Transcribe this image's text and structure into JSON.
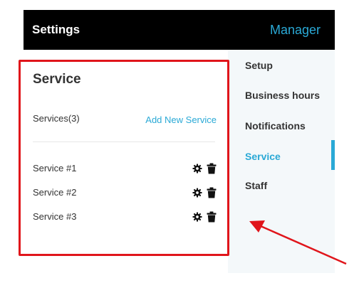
{
  "header": {
    "title": "Settings",
    "role": "Manager"
  },
  "sidebar": {
    "items": [
      {
        "label": "Setup"
      },
      {
        "label": "Business hours"
      },
      {
        "label": "Notifications"
      },
      {
        "label": "Service"
      },
      {
        "label": "Staff"
      }
    ],
    "active": "Service"
  },
  "panel": {
    "title": "Service",
    "count_label": "Services(3)",
    "add_label": "Add New Service",
    "services": [
      {
        "name": "Service #1"
      },
      {
        "name": "Service #2"
      },
      {
        "name": "Service #3"
      }
    ]
  },
  "colors": {
    "accent": "#2aa9d6",
    "highlight": "#e0151b",
    "header_bg": "#000000"
  }
}
